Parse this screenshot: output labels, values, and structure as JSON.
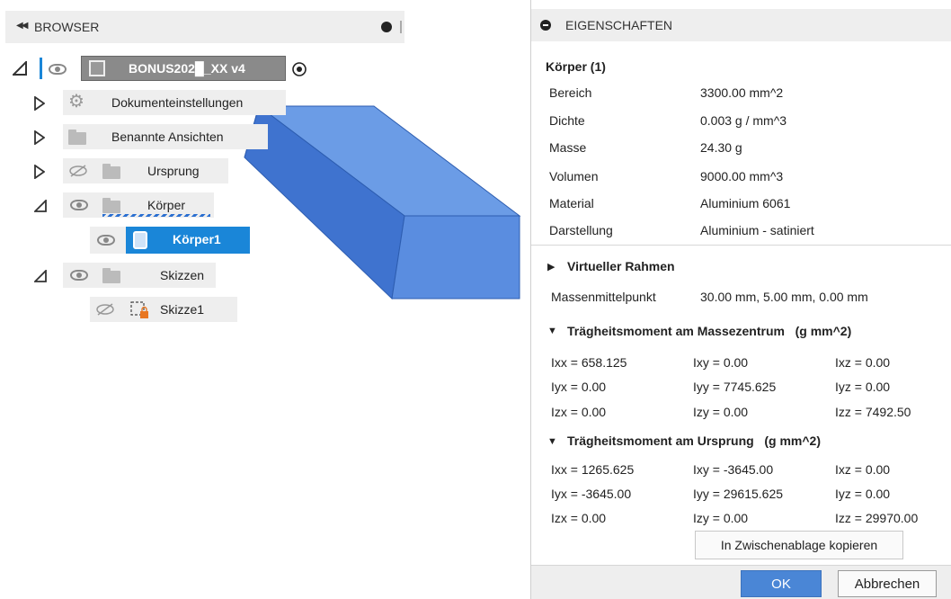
{
  "browser": {
    "title": "BROWSER",
    "root": {
      "label": "BONUS202█_XX v4"
    },
    "items": [
      {
        "label": "Dokumenteinstellungen"
      },
      {
        "label": "Benannte Ansichten"
      },
      {
        "label": "Ursprung"
      },
      {
        "label": "Körper"
      },
      {
        "label": "Körper1"
      },
      {
        "label": "Skizzen"
      },
      {
        "label": "Skizze1"
      }
    ]
  },
  "props": {
    "title": "EIGENSCHAFTEN",
    "body_title": "Körper (1)",
    "rows": [
      {
        "label": "Bereich",
        "value": "3300.00 mm^2"
      },
      {
        "label": "Dichte",
        "value": "0.003 g / mm^3"
      },
      {
        "label": "Masse",
        "value": "24.30 g"
      },
      {
        "label": "Volumen",
        "value": "9000.00 mm^3"
      },
      {
        "label": "Material",
        "value": "Aluminium 6061"
      },
      {
        "label": "Darstellung",
        "value": "Aluminium - satiniert"
      }
    ],
    "virtual_frame": "Virtueller Rahmen",
    "mass_center_label": "Massenmittelpunkt",
    "mass_center_value": "30.00 mm, 5.00 mm, 0.00 mm",
    "inertia_center_title": "Trägheitsmoment am Massezentrum   (g mm^2)",
    "inertia_center": [
      [
        "Ixx = 658.125",
        "Ixy = 0.00",
        "Ixz = 0.00"
      ],
      [
        "Iyx = 0.00",
        "Iyy = 7745.625",
        "Iyz = 0.00"
      ],
      [
        "Izx = 0.00",
        "Izy = 0.00",
        "Izz = 7492.50"
      ]
    ],
    "inertia_origin_title": "Trägheitsmoment am Ursprung   (g mm^2)",
    "inertia_origin": [
      [
        "Ixx = 1265.625",
        "Ixy = -3645.00",
        "Ixz = 0.00"
      ],
      [
        "Iyx = -3645.00",
        "Iyy = 29615.625",
        "Iyz = 0.00"
      ],
      [
        "Izx = 0.00",
        "Izy = 0.00",
        "Izz = 29970.00"
      ]
    ],
    "copy_label": "In Zwischenablage kopieren",
    "ok_label": "OK",
    "cancel_label": "Abbrechen"
  },
  "colors": {
    "accent": "#4a86d6",
    "selection": "#1a86d8",
    "body_blue": "#5b8ee0"
  }
}
